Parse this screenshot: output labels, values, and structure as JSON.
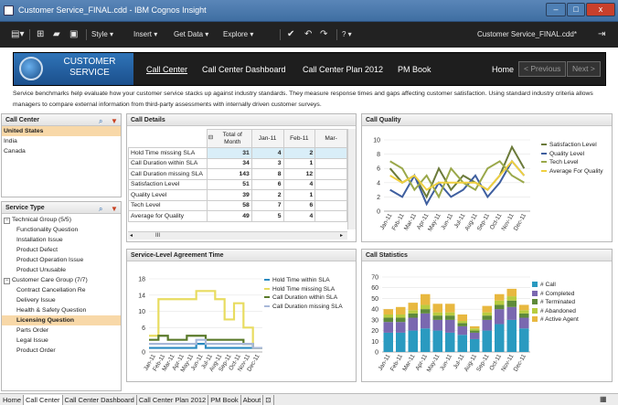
{
  "window": {
    "title": "Customer Service_FINAL.cdd - IBM Cognos Insight",
    "minimize": "–",
    "maximize": "□",
    "close": "x"
  },
  "toolbar": {
    "style": "Style ▾",
    "insert": "Insert ▾",
    "getdata": "Get Data ▾",
    "explore": "Explore ▾",
    "help": "? ▾",
    "document": "Customer Service_FINAL.cdd*"
  },
  "banner": {
    "logo_text": "CUSTOMER SERVICE",
    "nav": [
      "Call Center",
      "Call Center Dashboard",
      "Call Center Plan 2012",
      "PM Book"
    ],
    "home": "Home",
    "previous": "< Previous",
    "next": "Next >"
  },
  "description": "Service benchmarks help evaluate how your customer service stacks up against industry standards. They measure response times and gaps affecting customer satisfaction. Using standard industry criteria allows managers to compare external information from third-party assessments with internally driven customer surveys.",
  "call_center_panel": {
    "title": "Call Center",
    "items": [
      "United States",
      "India",
      "Canada"
    ],
    "selected": 0
  },
  "service_type_panel": {
    "title": "Service Type",
    "items": [
      {
        "label": "Technical Group (5/5)",
        "level": 0,
        "expander": "−"
      },
      {
        "label": "Functionality Question",
        "level": 1
      },
      {
        "label": "Installation Issue",
        "level": 1
      },
      {
        "label": "Product Defect",
        "level": 1
      },
      {
        "label": "Product Operation Issue",
        "level": 1
      },
      {
        "label": "Product Unusable",
        "level": 1
      },
      {
        "label": "Customer Care Group (7/7)",
        "level": 0,
        "expander": "−"
      },
      {
        "label": "Contract Cancellation Re",
        "level": 1
      },
      {
        "label": "Delivery Issue",
        "level": 1
      },
      {
        "label": "Health & Safety Question",
        "level": 1
      },
      {
        "label": "Licensing Question",
        "level": 1,
        "selected": true
      },
      {
        "label": "Parts Order",
        "level": 1
      },
      {
        "label": "Legal Issue",
        "level": 1
      },
      {
        "label": "Product Order",
        "level": 1
      }
    ]
  },
  "call_details": {
    "title": "Call Details",
    "col_headers": [
      "Total of Month",
      "Jan-11",
      "Feb-11",
      "Mar-"
    ],
    "expander": "⊟",
    "rows": [
      {
        "label": "Hold Time missing SLA",
        "values": [
          "31",
          "4",
          "2"
        ]
      },
      {
        "label": "Call Duration within SLA",
        "values": [
          "34",
          "3",
          "1"
        ]
      },
      {
        "label": "Call Duration missing SLA",
        "values": [
          "143",
          "8",
          "12"
        ]
      },
      {
        "label": "Satisfaction Level",
        "values": [
          "51",
          "6",
          "4"
        ]
      },
      {
        "label": "Quality Level",
        "values": [
          "39",
          "2",
          "1"
        ]
      },
      {
        "label": "Tech Level",
        "values": [
          "58",
          "7",
          "6"
        ]
      },
      {
        "label": "Average for Quality",
        "values": [
          "49",
          "5",
          "4"
        ]
      }
    ],
    "scroll_indicator": "III"
  },
  "colors": {
    "satisfaction": "#6b7a3a",
    "quality": "#3f5f9f",
    "tech": "#9aa84a",
    "avg_quality": "#f0d040",
    "call": "#2a9ac0",
    "completed": "#7a68b0",
    "terminated": "#5e8a3a",
    "abandoned": "#b8cc40",
    "active": "#e8b840",
    "hold_within": "#2a8ac0",
    "hold_missing": "#e8dc60",
    "dur_within": "#5a7a2a",
    "dur_missing": "#a8b8d8"
  },
  "chart_data": [
    {
      "type": "line",
      "title": "Call Quality",
      "x": [
        "Jan-11",
        "Feb-11",
        "Mar-11",
        "Apr-11",
        "May-11",
        "Jun-11",
        "Jul-11",
        "Aug-11",
        "Sep-11",
        "Oct-11",
        "Nov-11",
        "Dec-11"
      ],
      "ylim": [
        0,
        10
      ],
      "yticks": [
        "0",
        "2",
        "4",
        "6",
        "8",
        "10"
      ],
      "series": [
        {
          "name": "Satisfaction Level",
          "values": [
            6,
            4,
            5,
            2,
            6,
            3,
            5,
            4,
            3,
            5,
            9,
            6
          ]
        },
        {
          "name": "Quality Level",
          "values": [
            3,
            2,
            5,
            1,
            4,
            2,
            3,
            5,
            2,
            4,
            7,
            5
          ]
        },
        {
          "name": "Tech Level",
          "values": [
            7,
            6,
            3,
            5,
            2,
            6,
            4,
            3,
            6,
            7,
            5,
            4
          ]
        },
        {
          "name": "Average For Quality",
          "values": [
            5,
            4,
            5,
            3,
            4,
            4,
            4,
            4,
            3,
            5,
            7,
            5
          ]
        }
      ]
    },
    {
      "type": "line",
      "title": "Service-Level Agreement Time",
      "x": [
        "Jan-11",
        "Feb-11",
        "Mar-11",
        "Apr-11",
        "May-11",
        "Jun-11",
        "Jul-11",
        "Aug-11",
        "Sep-11",
        "Oct-11",
        "Nov-11",
        "Dec-11"
      ],
      "ylim": [
        0,
        18
      ],
      "yticks": [
        "0",
        "6",
        "10",
        "14",
        "18"
      ],
      "series": [
        {
          "name": "Hold Time within SLA",
          "values": [
            1,
            1,
            1,
            1,
            1,
            2,
            1,
            1,
            1,
            1,
            1,
            1
          ]
        },
        {
          "name": "Hold Time missing SLA",
          "values": [
            4,
            13,
            13,
            13,
            13,
            15,
            15,
            13,
            8,
            12,
            6,
            1
          ]
        },
        {
          "name": "Call Duration within SLA",
          "values": [
            3,
            4,
            3,
            3,
            4,
            4,
            3,
            3,
            3,
            3,
            2,
            1
          ]
        },
        {
          "name": "Call Duration missing SLA",
          "values": [
            2,
            2,
            2,
            2,
            2,
            3,
            2,
            2,
            2,
            2,
            2,
            1
          ]
        }
      ]
    },
    {
      "type": "bar",
      "title": "Call Statistics",
      "categories": [
        "Jan-11",
        "Feb-11",
        "Mar-11",
        "Apr-11",
        "May-11",
        "Jun-11",
        "Jul-11",
        "Aug-11",
        "Sep-11",
        "Oct-11",
        "Nov-11",
        "Dec-11"
      ],
      "ylim": [
        0,
        70
      ],
      "yticks": [
        "0",
        "10",
        "20",
        "30",
        "40",
        "50",
        "60",
        "70"
      ],
      "series": [
        {
          "name": "# Call",
          "values": [
            18,
            18,
            20,
            22,
            20,
            18,
            16,
            12,
            20,
            26,
            30,
            22
          ]
        },
        {
          "name": "# Completed",
          "values": [
            10,
            10,
            12,
            14,
            10,
            12,
            8,
            6,
            10,
            14,
            12,
            10
          ]
        },
        {
          "name": "# Terminated",
          "values": [
            4,
            4,
            4,
            4,
            4,
            4,
            3,
            2,
            4,
            4,
            6,
            4
          ]
        },
        {
          "name": "# Abandoned",
          "values": [
            3,
            3,
            3,
            4,
            3,
            3,
            2,
            2,
            3,
            4,
            4,
            3
          ]
        },
        {
          "name": "# Active Agent",
          "values": [
            5,
            7,
            7,
            10,
            8,
            8,
            6,
            2,
            6,
            6,
            7,
            5
          ]
        }
      ]
    }
  ],
  "status_tabs": [
    "Home",
    "Call Center",
    "Call Center Dashboard",
    "Call Center Plan 2012",
    "PM Book",
    "About"
  ],
  "status_active": 1
}
